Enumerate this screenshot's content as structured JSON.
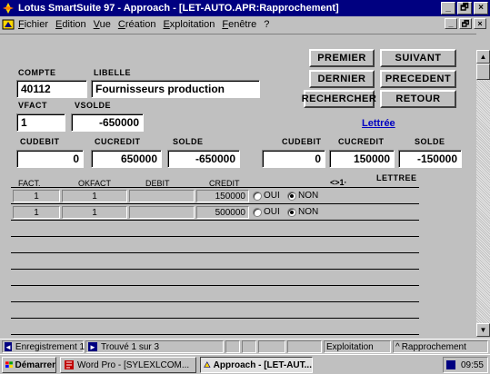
{
  "window": {
    "title": "Lotus SmartSuite 97  -  Approach - [LET-AUTO.APR:Rapprochement]",
    "controls": [
      "_",
      "🗗",
      "×"
    ]
  },
  "menu": {
    "items": [
      "Fichier",
      "Edition",
      "Vue",
      "Création",
      "Exploitation",
      "Fenêtre",
      "?"
    ]
  },
  "nav": {
    "premier": "PREMIER",
    "suivant": "SUIVANT",
    "dernier": "DERNIER",
    "precedent": "PRECEDENT",
    "rechercher": "RECHERCHER",
    "retour": "RETOUR",
    "lettree_link": "Lettrée"
  },
  "form": {
    "compte_label": "COMPTE",
    "compte_value": "40112",
    "libelle_label": "LIBELLE",
    "libelle_value": "Fournisseurs production",
    "vfact_label": "VFACT",
    "vfact_value": "1",
    "vsolde_label": "VSOLDE",
    "vsolde_value": "-650000",
    "left": {
      "cudebit_label": "CUDEBIT",
      "cudebit_value": "0",
      "cucredit_label": "CUCREDIT",
      "cucredit_value": "650000",
      "solde_label": "SOLDE",
      "solde_value": "-650000"
    },
    "right": {
      "cudebit_label": "CUDEBIT",
      "cudebit_value": "0",
      "cucredit_label": "CUCREDIT",
      "cucredit_value": "150000",
      "solde_label": "SOLDE",
      "solde_value": "-150000"
    }
  },
  "grid": {
    "headers": {
      "fact": "FACT.",
      "okfact": "OKFACT",
      "debit": "DEBIT",
      "credit": "CREDIT",
      "filter": "<>1·",
      "lettree": "LETTREE"
    },
    "radio_oui": "OUI",
    "radio_non": "NON",
    "rows": [
      {
        "fact": "1",
        "okfact": "1",
        "debit": "",
        "credit": "150000",
        "lettree": "NON"
      },
      {
        "fact": "1",
        "okfact": "1",
        "debit": "",
        "credit": "500000",
        "lettree": "NON"
      }
    ]
  },
  "status": {
    "record": "Enregistrement 1",
    "found": "Trouvé 1 sur 3",
    "mode": "Exploitation",
    "view": "Rapprochement"
  },
  "taskbar": {
    "start": "Démarrer",
    "task1": "Word Pro - [SYLEXLCOM...",
    "task2": "Approach - [LET-AUT...",
    "clock": "09:55"
  }
}
